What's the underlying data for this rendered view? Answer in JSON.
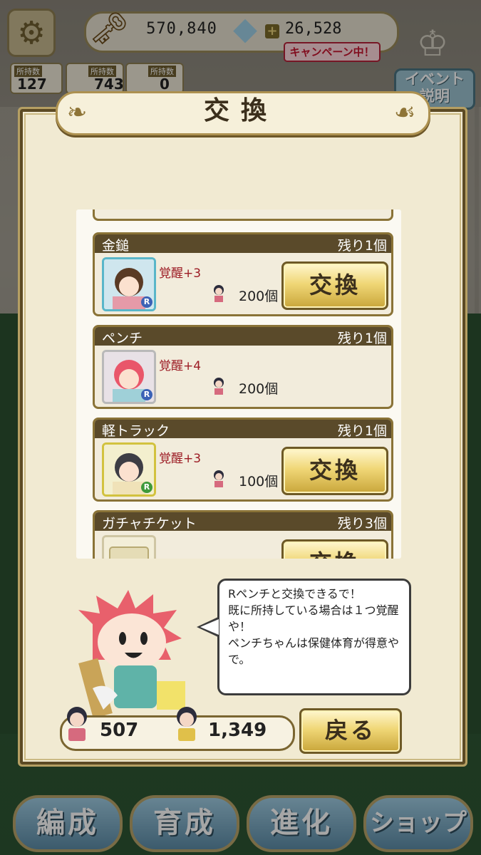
{
  "hud": {
    "money": "570,840",
    "gems": "26,528",
    "campaign": "キャンペーン中！",
    "owned": [
      {
        "label": "所持数",
        "value": "127"
      },
      {
        "label": "所持数",
        "value": "743"
      },
      {
        "label": "所持数",
        "value": "0"
      }
    ],
    "event_button": "イベント\n説明"
  },
  "dialog": {
    "title": "交換",
    "items": [
      {
        "name": "金鎚",
        "remaining": "残り1個",
        "awaken": "覚醒+3",
        "cost": "200個",
        "button": "交換",
        "has_button": true
      },
      {
        "name": "ペンチ",
        "remaining": "残り1個",
        "awaken": "覚醒+4",
        "cost": "200個",
        "button": "",
        "has_button": false
      },
      {
        "name": "軽トラック",
        "remaining": "残り1個",
        "awaken": "覚醒+3",
        "cost": "100個",
        "button": "交換",
        "has_button": true
      },
      {
        "name": "ガチャチケット",
        "remaining": "残り3個",
        "awaken": "",
        "cost": "",
        "button": "交換",
        "has_button": true
      }
    ],
    "bubble_text": "Rペンチと交換できるで！\n既に所持している場合は１つ覚醒や！\nペンチちゃんは保健体育が得意やで。",
    "currency_1": "507",
    "currency_2": "1,349",
    "back_button": "戻る"
  },
  "nav": [
    "編成",
    "育成",
    "進化",
    "ショップ"
  ]
}
